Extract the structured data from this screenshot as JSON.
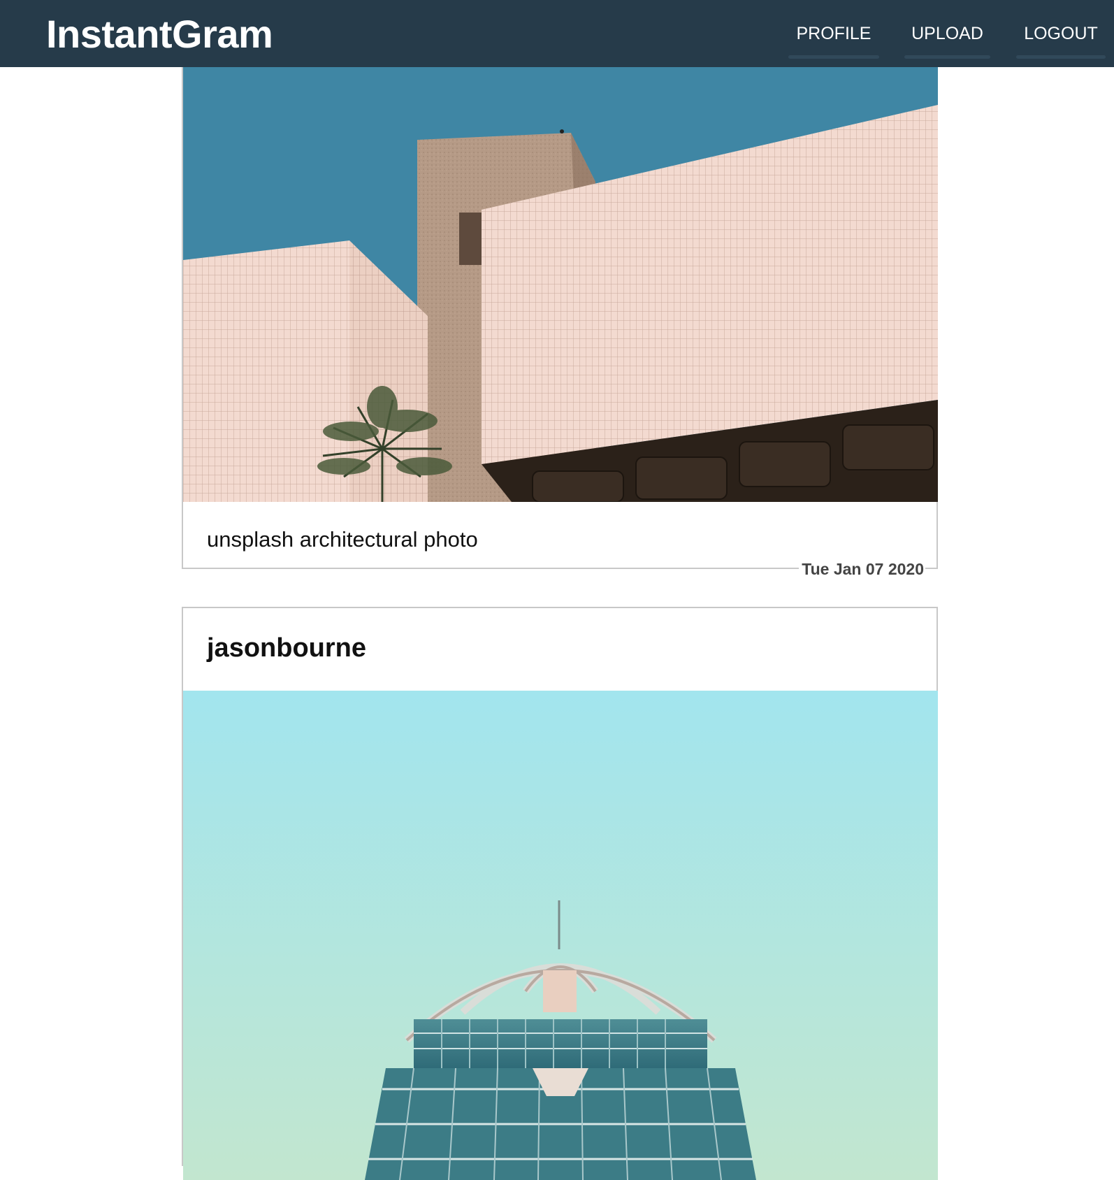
{
  "app": {
    "brand": "InstantGram"
  },
  "nav": {
    "profile": "PROFILE",
    "upload": "UPLOAD",
    "logout": "LOGOUT"
  },
  "colors": {
    "navbar": "#263b4a",
    "nav_underline": "#31495a",
    "card_border": "#c8c8c8"
  },
  "posts": [
    {
      "caption": "unsplash architectural photo",
      "date": "Tue Jan 07 2020"
    },
    {
      "username": "jasonbourne"
    }
  ]
}
